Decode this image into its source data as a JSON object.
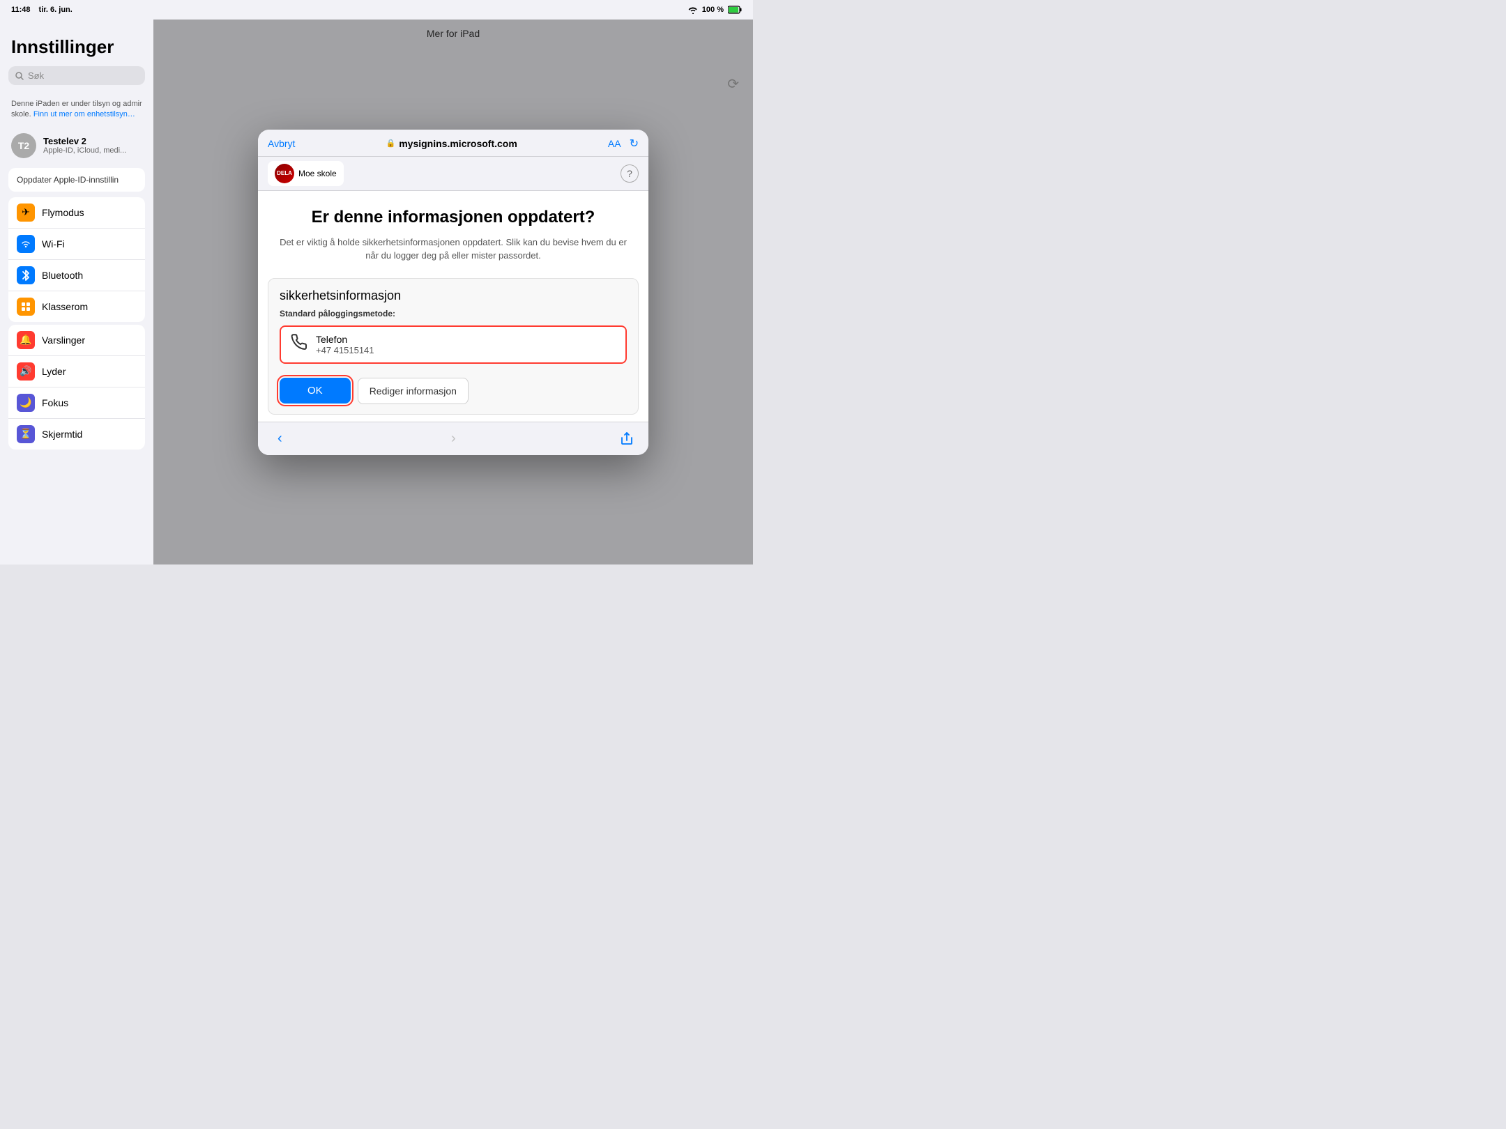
{
  "statusBar": {
    "time": "11:48",
    "day": "tir. 6. jun.",
    "battery": "100 %",
    "wifiIcon": "wifi"
  },
  "sidebar": {
    "title": "Innstillinger",
    "search": {
      "placeholder": "Søk"
    },
    "adminNotice": "Denne iPaden er under tilsyn og admir skole.",
    "adminLink": "Finn ut mer om enhetstilsyn…",
    "user": {
      "initials": "T2",
      "name": "Testelev 2",
      "subtitle": "Apple-ID, iCloud, medi..."
    },
    "updateBanner": "Oppdater Apple-ID-innstillin",
    "items": [
      {
        "id": "flymodus",
        "label": "Flymodus",
        "icon": "✈",
        "color": "orange"
      },
      {
        "id": "wifi",
        "label": "Wi-Fi",
        "icon": "wifi",
        "color": "blue"
      },
      {
        "id": "bluetooth",
        "label": "Bluetooth",
        "icon": "bluetooth",
        "color": "blue2"
      },
      {
        "id": "klasserom",
        "label": "Klasserom",
        "icon": "⊞",
        "color": "orange2"
      }
    ],
    "items2": [
      {
        "id": "varslinger",
        "label": "Varslinger",
        "icon": "🔔",
        "color": "red"
      },
      {
        "id": "lyder",
        "label": "Lyder",
        "icon": "🔊",
        "color": "red2"
      },
      {
        "id": "fokus",
        "label": "Fokus",
        "icon": "🌙",
        "color": "indigo"
      },
      {
        "id": "skjermtid",
        "label": "Skjermtid",
        "icon": "⏳",
        "color": "purple"
      }
    ]
  },
  "rightPanel": {
    "header": "Mer for iPad"
  },
  "browser": {
    "cancelLabel": "Avbryt",
    "url": "mysignins.microsoft.com",
    "aaLabel": "AA",
    "schoolTab": "Moe skole",
    "helpLabel": "?",
    "content": {
      "title": "Er denne informasjonen oppdatert?",
      "description": "Det er viktig å holde sikkerhetsinformasjonen oppdatert. Slik kan du bevise hvem du er når du logger deg på eller mister passordet.",
      "sectionTitle": "sikkerhetsinformasjon",
      "methodLabel": "Standard påloggingsmetode:",
      "phoneName": "Telefon",
      "phoneNumber": "+47 41515141",
      "okLabel": "OK",
      "editLabel": "Rediger informasjon"
    },
    "nav": {
      "backLabel": "‹",
      "forwardLabel": "›",
      "shareLabel": "share"
    }
  }
}
